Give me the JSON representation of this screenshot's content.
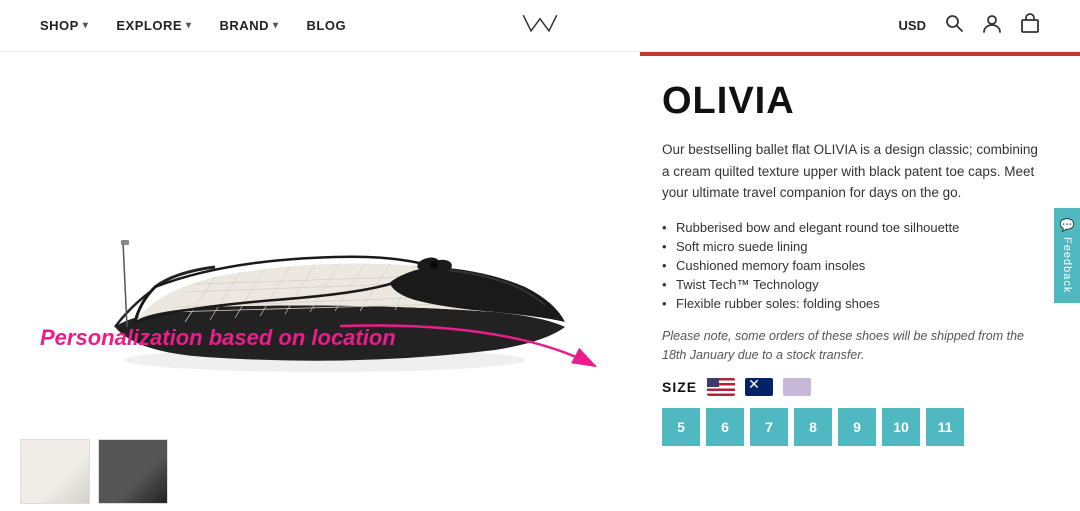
{
  "nav": {
    "items": [
      {
        "label": "SHOP",
        "has_dropdown": true
      },
      {
        "label": "EXPLORE",
        "has_dropdown": true
      },
      {
        "label": "BRAND",
        "has_dropdown": true
      },
      {
        "label": "BLOG",
        "has_dropdown": false
      }
    ],
    "currency": "USD",
    "icons": {
      "search": "🔍",
      "user": "👤",
      "bag": "🛍"
    }
  },
  "product": {
    "title": "OLIVIA",
    "description": "Our bestselling ballet flat OLIVIA is a design classic; combining a cream quilted texture upper with black patent toe caps. Meet your ultimate travel companion for days on the go.",
    "features": [
      "Rubberised bow and elegant round toe silhouette",
      "Soft micro suede lining",
      "Cushioned memory foam insoles",
      "Twist Tech™ Technology",
      "Flexible rubber soles: folding shoes"
    ],
    "shipping_note": "Please note, some orders of these shoes will be shipped from the 18th January due to a stock transfer.",
    "size_label": "SIZE",
    "sizes": [
      "5",
      "6",
      "7",
      "8",
      "9",
      "10",
      "11"
    ]
  },
  "annotation": {
    "personalization_text": "Personalization based on location"
  },
  "feedback": {
    "label": "Feedback"
  }
}
